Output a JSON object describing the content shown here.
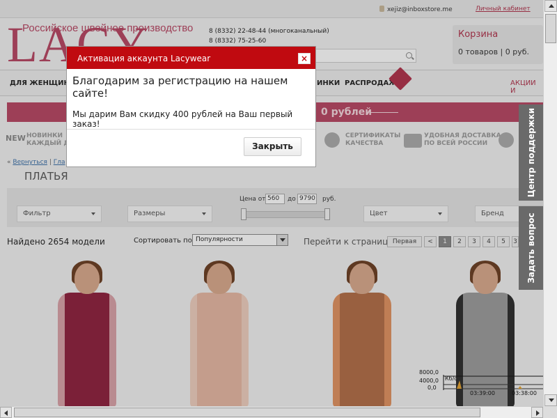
{
  "topbar": {
    "email": "xejiz@inboxstore.me",
    "cabinet_link": "Личный кабинет"
  },
  "header": {
    "logo_subtitle": "Российское швейное производство",
    "logo": "LACY",
    "phone_1": "8 (8332) 22-48-44 (многоканальный)",
    "phone_2": "8 (8332) 75-25-60"
  },
  "cart": {
    "title": "Корзина",
    "info": "0 товаров | 0 руб."
  },
  "nav": {
    "items": [
      "ДЛЯ ЖЕНЩИН",
      "ИНКИ",
      "РАСПРОДАЖА"
    ],
    "badge": "NEW",
    "right_link": "АКЦИИ И"
  },
  "promo": {
    "text": "0 рублей"
  },
  "features": {
    "new_label": "NEW",
    "novelty": "НОВИНКИ\nКАЖДЫЙ ДЕ",
    "certificates": "СЕРТИФИКАТЫ\nКАЧЕСТВА",
    "delivery": "УДОБНАЯ ДОСТАВКА\nПО ВСЕЙ РОССИИ"
  },
  "breadcrumb": {
    "back": "Вернуться",
    "home": "Гла",
    "prefix": "«",
    "sep": "|"
  },
  "page_title": "ПЛАТЬЯ",
  "price_filter": {
    "label_from": "Цена от",
    "from": "560",
    "label_to": "до",
    "to": "9790",
    "currency": "руб."
  },
  "filters": [
    "Фильтр",
    "Размеры",
    "Цвет",
    "Бренд"
  ],
  "listing": {
    "found": "Найдено 2654 модели",
    "sort_label": "Сортировать по:",
    "sort_value": "Популярности",
    "goto_label": "Перейти к странице:",
    "pages": [
      "Первая",
      "<",
      "1",
      "2",
      "3",
      "4",
      "5",
      "3"
    ]
  },
  "products": [
    {
      "dress_color": "#8e1f3c",
      "accent": "#d9a2a8"
    },
    {
      "dress_color": "#e7b7a3",
      "accent": "#f0cfbf"
    },
    {
      "dress_color": "#b26d46",
      "accent": "#e19260"
    },
    {
      "dress_color": "#9b9b9b",
      "accent": "#2b2b2b"
    }
  ],
  "graph": {
    "y_top": "8000,0",
    "y_mid": "4000,0",
    "y_bot": "0,0",
    "unit": "Кб/с",
    "t1": "03:39:00",
    "t2": "03:38:00"
  },
  "side_tabs": {
    "support": "Центр поддержки",
    "ask": "Задать вопрос"
  },
  "modal": {
    "title": "Активация аккаунта Lacywear",
    "close_icon": "×",
    "message_1": "Благодарим за регистрацию на нашем сайте!",
    "message_2": "Мы дарим Вам скидку 400 рублей на Ваш первый заказ!",
    "close_button": "Закрыть"
  },
  "colors": {
    "brand": "#b84562",
    "modal_header": "#c00a10",
    "link": "#3a6fa8"
  }
}
